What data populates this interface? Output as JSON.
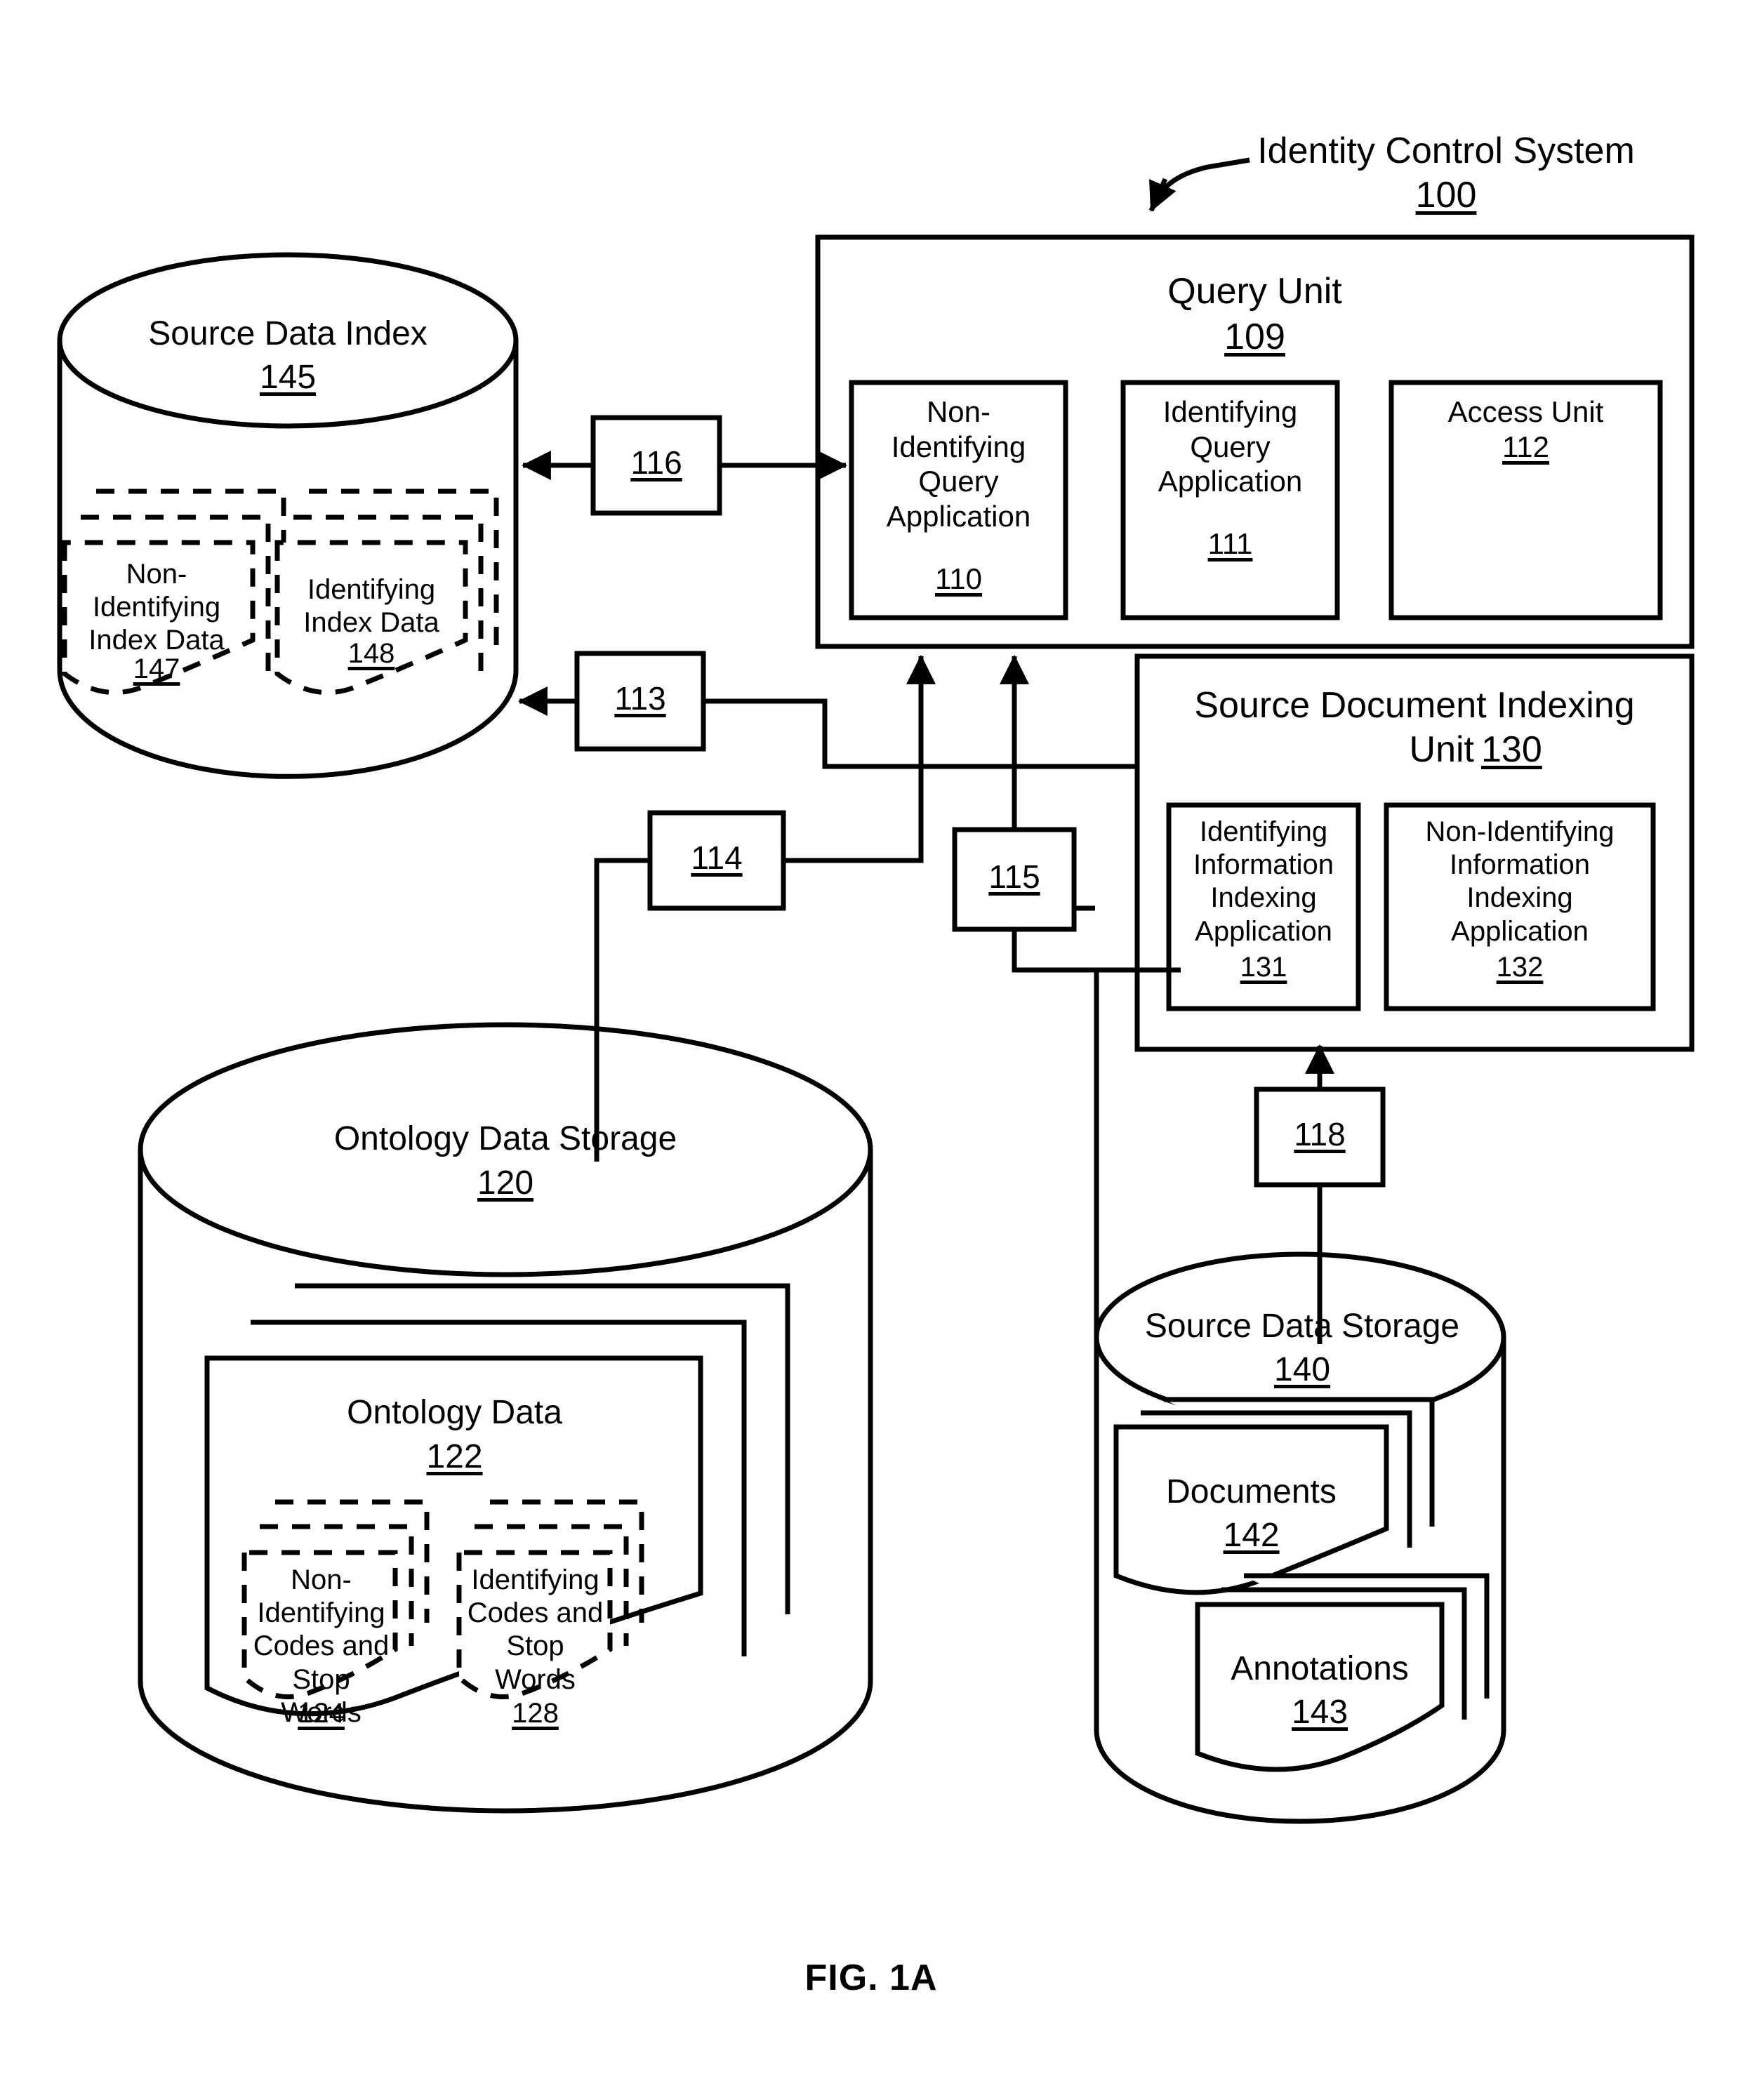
{
  "figure": {
    "caption": "FIG. 1A",
    "system_label": "Identity Control System",
    "system_ref": "100"
  },
  "nodes": {
    "query_unit": {
      "title": "Query Unit",
      "ref": "109",
      "children": [
        {
          "title": "Non-\nIdentifying\nQuery\nApplication",
          "ref": "110"
        },
        {
          "title": "Identifying\nQuery\nApplication",
          "ref": "111"
        },
        {
          "title": "Access Unit",
          "ref": "112"
        }
      ]
    },
    "source_document_indexing_unit": {
      "title_line1": "Source Document Indexing",
      "title_line2": "Unit",
      "ref": "130",
      "children": [
        {
          "title": "Identifying\nInformation\nIndexing\nApplication",
          "ref": "131"
        },
        {
          "title": "Non-Identifying\nInformation\nIndexing\nApplication",
          "ref": "132"
        }
      ]
    },
    "source_data_index": {
      "title": "Source Data Index",
      "ref": "145",
      "docs": [
        {
          "title": "Non-\nIdentifying\nIndex Data",
          "ref": "147"
        },
        {
          "title": "Identifying\nIndex Data",
          "ref": "148"
        }
      ]
    },
    "ontology_data_storage": {
      "title": "Ontology Data Storage",
      "ref": "120",
      "stack_title": "Ontology Data",
      "stack_ref": "122",
      "docs": [
        {
          "title": "Non-\nIdentifying\nCodes and\nStop Words",
          "ref": "124"
        },
        {
          "title": "Identifying\nCodes and\nStop\nWords",
          "ref": "128"
        }
      ]
    },
    "source_data_storage": {
      "title": "Source Data Storage",
      "ref": "140",
      "stacks": [
        {
          "title": "Documents",
          "ref": "142"
        },
        {
          "title": "Annotations",
          "ref": "143"
        }
      ]
    }
  },
  "connectors": [
    {
      "id": "113",
      "ref": "113"
    },
    {
      "id": "114",
      "ref": "114"
    },
    {
      "id": "115",
      "ref": "115"
    },
    {
      "id": "116",
      "ref": "116"
    },
    {
      "id": "118",
      "ref": "118"
    }
  ],
  "colors": {
    "stroke": "#000000",
    "background": "#ffffff"
  }
}
